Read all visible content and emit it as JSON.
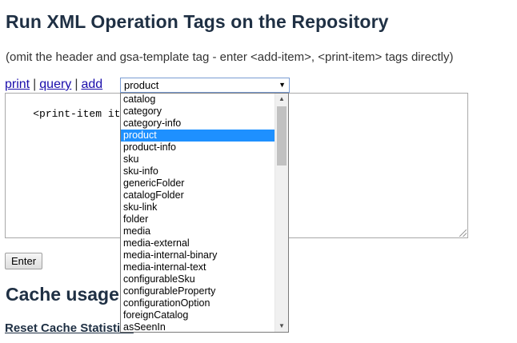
{
  "page": {
    "title": "Run XML Operation Tags on the Repository",
    "subtitle": "(omit the header and gsa-template tag - enter <add-item>, <print-item> tags directly)"
  },
  "links": {
    "print": "print",
    "separator": "|",
    "query": "query",
    "add": "add"
  },
  "editor": {
    "value": "<print-item item-de"
  },
  "select": {
    "value": "product",
    "arrow_icon": "dropdown-arrow-icon",
    "options": [
      "catalog",
      "category",
      "category-info",
      "product",
      "product-info",
      "sku",
      "sku-info",
      "genericFolder",
      "catalogFolder",
      "sku-link",
      "folder",
      "media",
      "media-external",
      "media-internal-binary",
      "media-internal-text",
      "configurableSku",
      "configurableProperty",
      "configurationOption",
      "foreignCatalog",
      "asSeenIn"
    ],
    "selected": "product",
    "selected_color": "#1e90ff"
  },
  "buttons": {
    "enter": "Enter"
  },
  "cache": {
    "heading": "Cache usage",
    "reset_link": "Reset Cache Statistics"
  },
  "colors": {
    "heading": "#1f3044",
    "link": "#1a0dab"
  }
}
